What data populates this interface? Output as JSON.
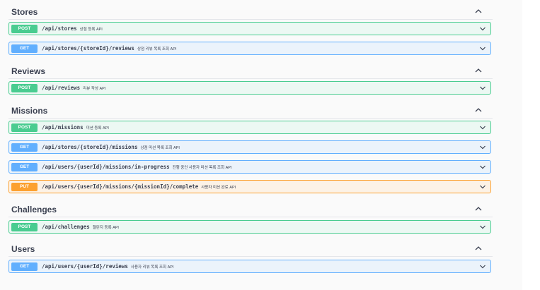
{
  "tags": [
    {
      "name": "Stores",
      "operations": [
        {
          "method": "POST",
          "path": "/api/stores",
          "summary": "상점 등록 API"
        },
        {
          "method": "GET",
          "path": "/api/stores/{storeId}/reviews",
          "summary": "상점 리뷰 목록 조회 API"
        }
      ]
    },
    {
      "name": "Reviews",
      "operations": [
        {
          "method": "POST",
          "path": "/api/reviews",
          "summary": "리뷰 작성 API"
        }
      ]
    },
    {
      "name": "Missions",
      "operations": [
        {
          "method": "POST",
          "path": "/api/missions",
          "summary": "미션 등록 API"
        },
        {
          "method": "GET",
          "path": "/api/stores/{storeId}/missions",
          "summary": "상점 미션 목록 조회 API"
        },
        {
          "method": "GET",
          "path": "/api/users/{userId}/missions/in-progress",
          "summary": "진행 중인 사용자 미션 목록 조회 API"
        },
        {
          "method": "PUT",
          "path": "/api/users/{userId}/missions/{missionId}/complete",
          "summary": "사용자 미션 완료 API"
        }
      ]
    },
    {
      "name": "Challenges",
      "operations": [
        {
          "method": "POST",
          "path": "/api/challenges",
          "summary": "챌린지 등록 API"
        }
      ]
    },
    {
      "name": "Users",
      "operations": [
        {
          "method": "GET",
          "path": "/api/users/{userId}/reviews",
          "summary": "사용자 리뷰 목록 조회 API"
        }
      ]
    }
  ],
  "icons": {
    "tag_toggle": "chevron-up-icon",
    "operation_toggle": "chevron-down-icon"
  },
  "colors": {
    "post": "#49cc90",
    "get": "#61affe",
    "put": "#fca130",
    "text": "#3b4151"
  }
}
